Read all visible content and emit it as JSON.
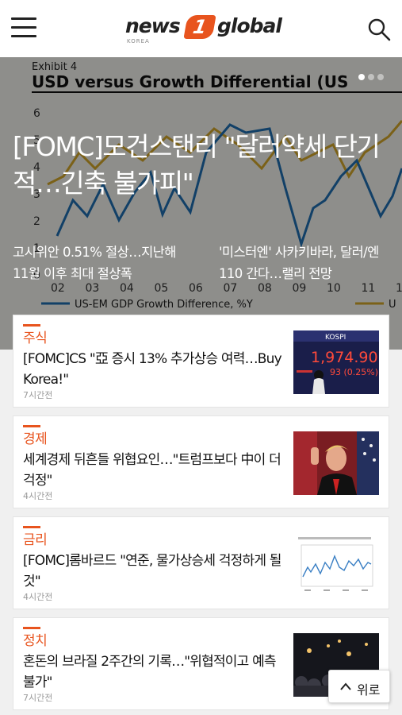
{
  "header": {
    "logo_news": "news",
    "logo_one": "1",
    "logo_global": "global",
    "logo_korea": "KOREA"
  },
  "hero": {
    "title": "[FOMC]모건스탠리 \"달러약세 단기적…긴축 불가피\"",
    "chart_exhibit": "Exhibit 4",
    "chart_title": "USD versus Growth Differential (US",
    "chart_y_ticks": [
      "6",
      "5",
      "4",
      "3",
      "2",
      "1",
      "0"
    ],
    "chart_x_ticks": [
      "02",
      "03",
      "04",
      "05",
      "06",
      "07",
      "08",
      "09",
      "10",
      "11",
      "1"
    ],
    "chart_legend_1": "US-EM GDP Growth Difference, %Y",
    "chart_legend_2": "U",
    "slide_count": 3,
    "active_slide": 1,
    "subs": [
      {
        "text": "고시위안 0.51% 절상…지난해 11월 이후 최대 절상폭"
      },
      {
        "text": "'미스터엔' 사카키바라, 달러/엔 110 간다…랠리 전망"
      }
    ]
  },
  "cards": [
    {
      "category": "주식",
      "title": "[FOMC]CS \"亞 증시 13% 추가상승 여력…Buy Korea!\"",
      "time": "7시간전",
      "thumb": "kospi-board-photo",
      "thumb_label": "KOSPI",
      "thumb_value": "1,974.90",
      "thumb_change": "93 (0.25%)"
    },
    {
      "category": "경제",
      "title": "세계경제 뒤흔들 위협요인…\"트럼프보다 中이 더 걱정\"",
      "time": "4시간전",
      "thumb": "politician-photo"
    },
    {
      "category": "금리",
      "title": "[FOMC]롬바르드 \"연준, 물가상승세 걱정하게 될 것\"",
      "time": "4시간전",
      "thumb": "line-chart-thumbnail"
    },
    {
      "category": "정치",
      "title": "혼돈의 브라질 2주간의 기록…\"위협적이고 예측불가\"",
      "time": "7시간전",
      "thumb": "night-crowd-photo"
    }
  ],
  "top_button": {
    "label": "위로"
  },
  "colors": {
    "accent": "#e8541e",
    "text": "#111111",
    "muted": "#999999"
  }
}
